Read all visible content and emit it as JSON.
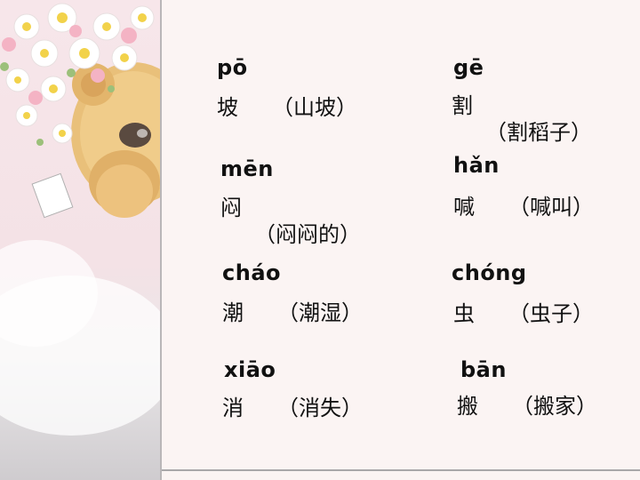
{
  "items": [
    {
      "pinyin": "pō",
      "char": "坡",
      "example": "（山坡）"
    },
    {
      "pinyin": "gē",
      "char": "割",
      "example": "（割稻子）"
    },
    {
      "pinyin": "mēn",
      "char": "闷",
      "example": "（闷闷的）"
    },
    {
      "pinyin": "hǎn",
      "char": "喊",
      "example": "（喊叫）"
    },
    {
      "pinyin": "cháo",
      "char": "潮",
      "example": "（潮湿）"
    },
    {
      "pinyin": "chóng",
      "char": "虫",
      "example": "（虫子）"
    },
    {
      "pinyin": "xiāo",
      "char": "消",
      "example": "（消失）"
    },
    {
      "pinyin": "bān",
      "char": "搬",
      "example": "（搬家）"
    }
  ]
}
